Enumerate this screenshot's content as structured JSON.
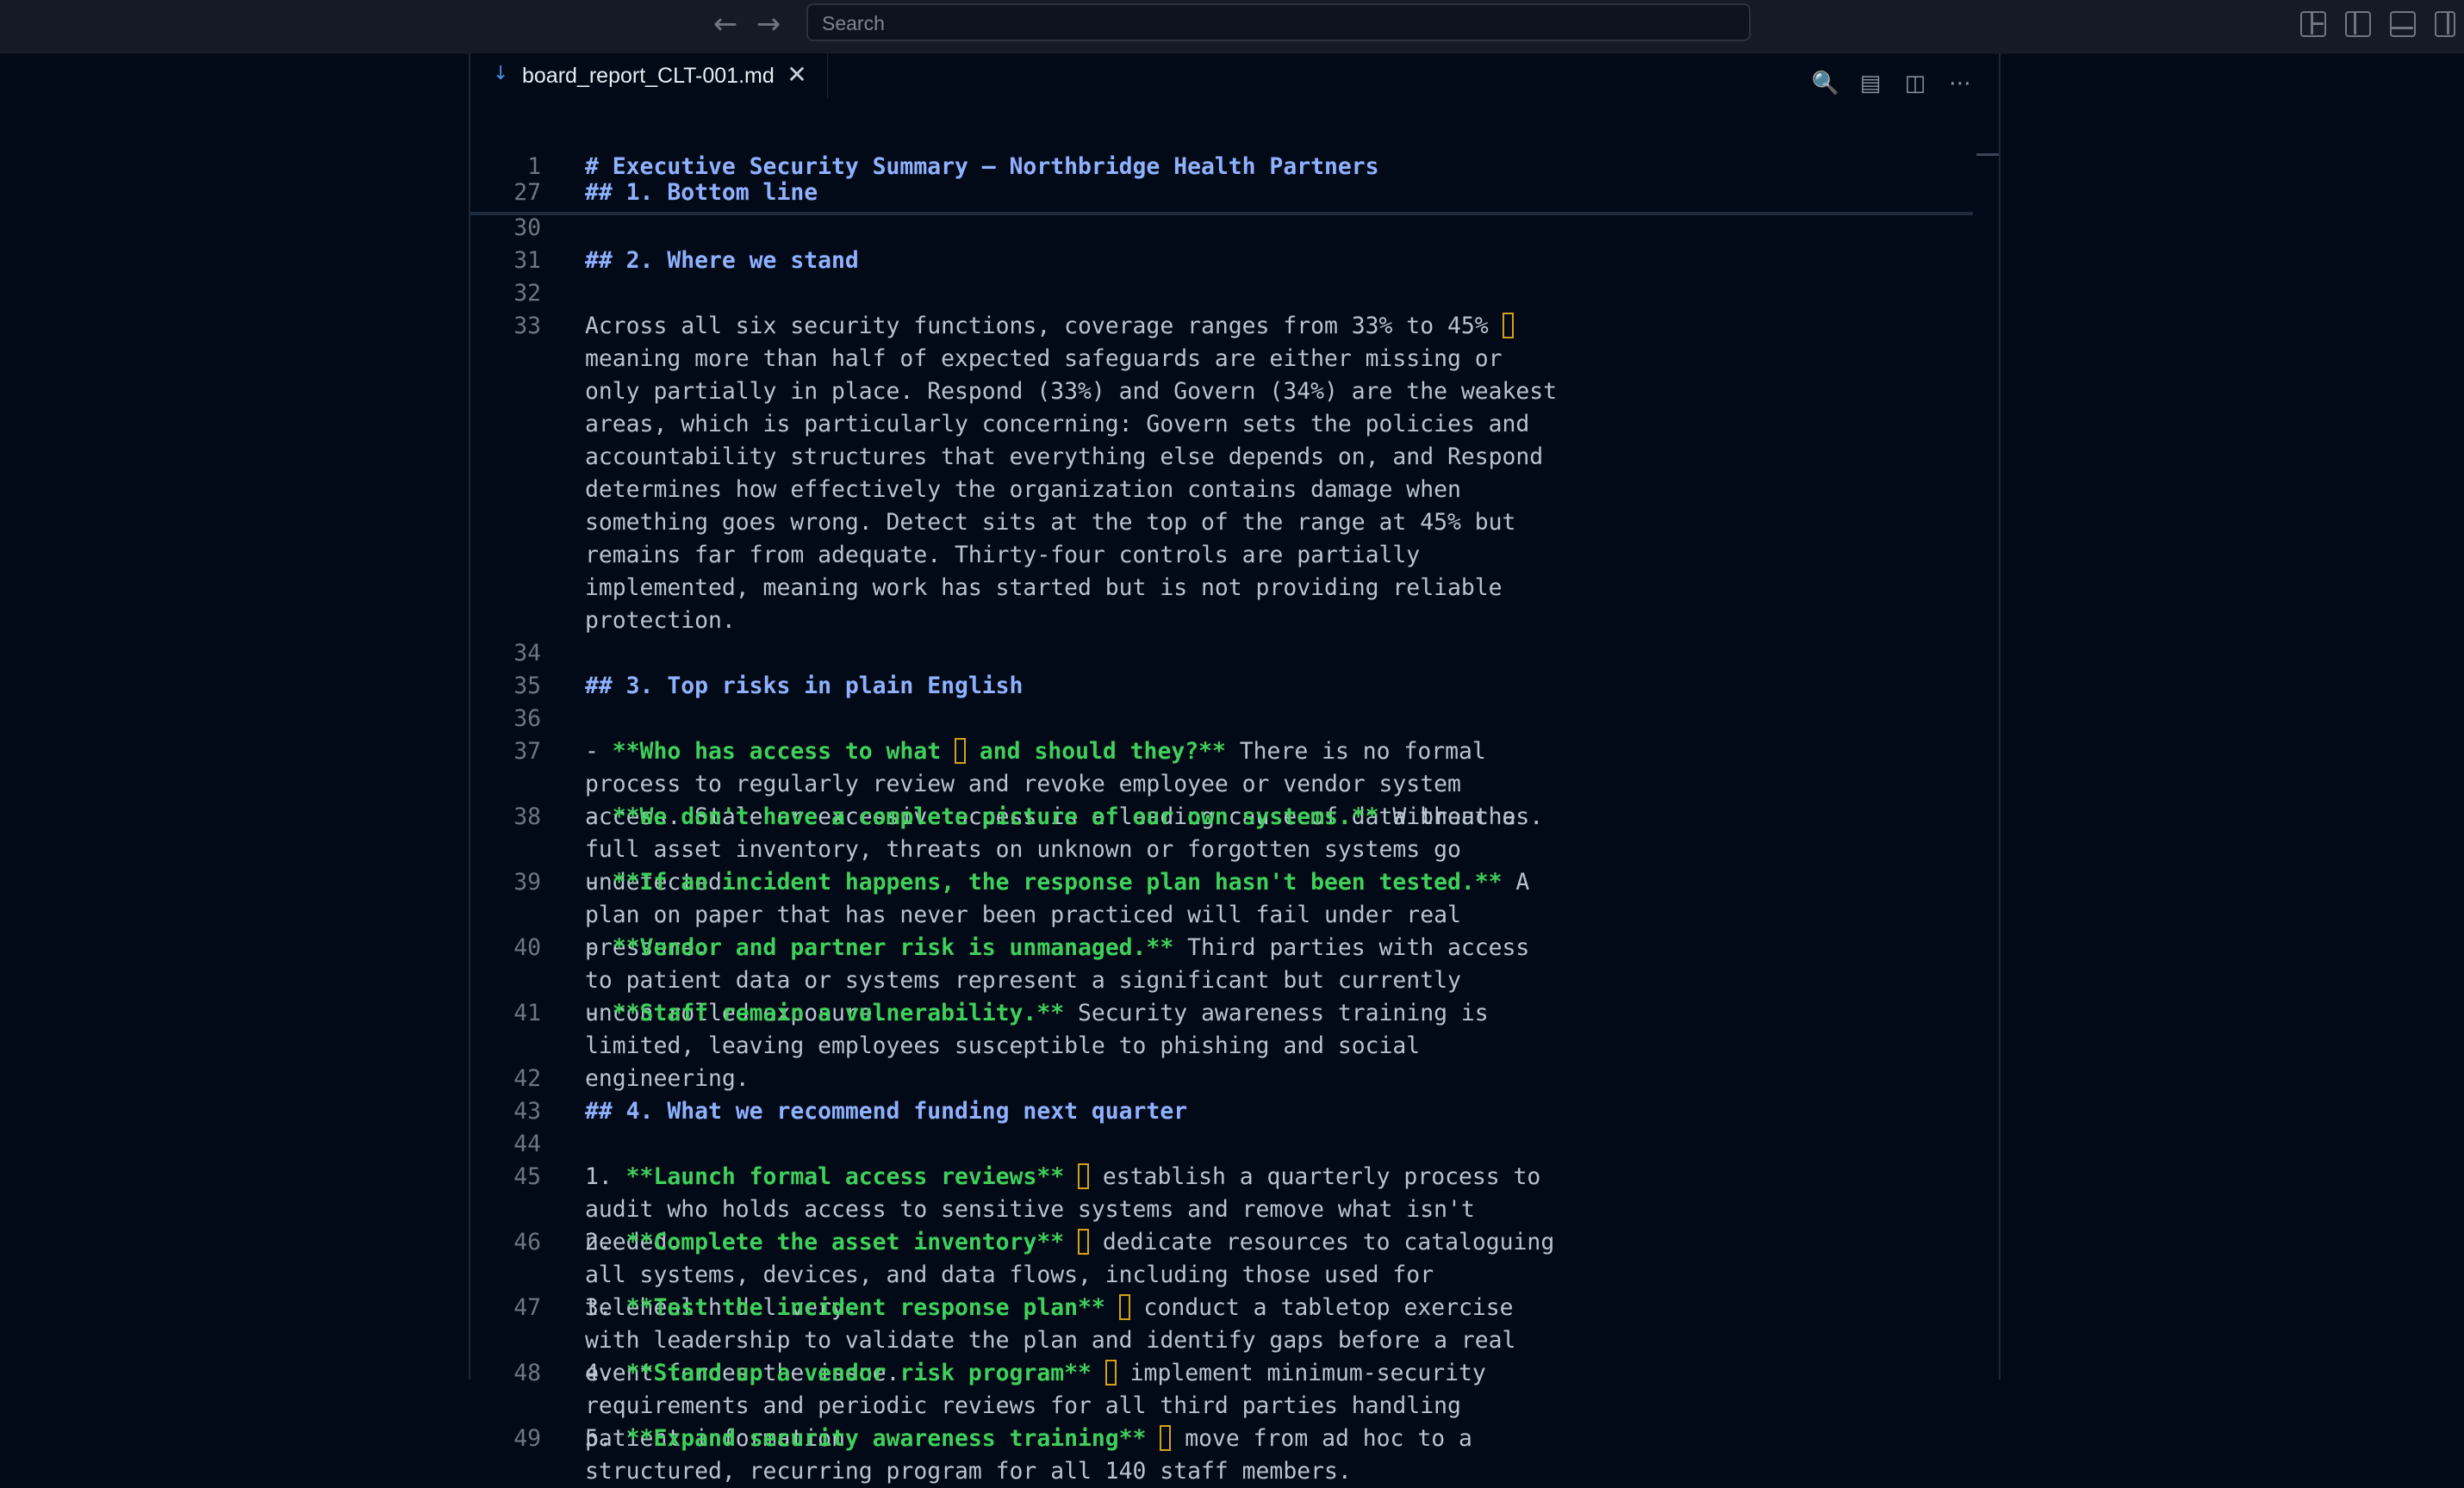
{
  "search": {
    "placeholder": "Search"
  },
  "tab": {
    "filename": "board_report_CLT-001.md"
  },
  "sticky": [
    {
      "ln": "1",
      "text": "# Executive Security Summary — Northbridge Health Partners"
    },
    {
      "ln": "27",
      "text": "## 1. Bottom line"
    }
  ],
  "lines": {
    "l30": {
      "ln": "30"
    },
    "l31": {
      "ln": "31",
      "text": "## 2. Where we stand"
    },
    "l32": {
      "ln": "32"
    },
    "l33": {
      "ln": "33",
      "a": "Across all six security functions, coverage ranges from 33% to 45% ",
      "b": " meaning more than half of expected safeguards are either missing or only partially in place. Respond (33%) and Govern (34%) are the weakest areas, which is particularly concerning: Govern sets the policies and accountability structures that everything else depends on, and Respond determines how effectively the organization contains damage when something goes wrong. Detect sits at the top of the range at 45% but remains far from adequate. Thirty-four controls are partially implemented, meaning work has started but is not providing reliable protection."
    },
    "l34": {
      "ln": "34"
    },
    "l35": {
      "ln": "35",
      "text": "## 3. Top risks in plain English"
    },
    "l36": {
      "ln": "36"
    },
    "l37": {
      "ln": "37",
      "m": "- ",
      "b1": "**Who has access to what ",
      "b2": " and should they?**",
      "rest": " There is no formal process to regularly review and revoke employee or vendor system access. Stale or excessive access is a leading cause of data breaches."
    },
    "l38": {
      "ln": "38",
      "m": "- ",
      "bold": "**We don't have a complete picture of our own systems.**",
      "rest": " Without a full asset inventory, threats on unknown or forgotten systems go undetected."
    },
    "l39": {
      "ln": "39",
      "m": "- ",
      "bold": "**If an incident happens, the response plan hasn't been tested.**",
      "rest": " A plan on paper that has never been practiced will fail under real pressure."
    },
    "l40": {
      "ln": "40",
      "m": "- ",
      "bold": "**Vendor and partner risk is unmanaged.**",
      "rest": " Third parties with access to patient data or systems represent a significant but currently uncontrolled exposure."
    },
    "l41": {
      "ln": "41",
      "m": "- ",
      "bold": "**Staff remain a vulnerability.**",
      "rest": " Security awareness training is limited, leaving employees susceptible to phishing and social engineering."
    },
    "l42": {
      "ln": "42"
    },
    "l43": {
      "ln": "43",
      "text": "## 4. What we recommend funding next quarter"
    },
    "l44": {
      "ln": "44"
    },
    "l45": {
      "ln": "45",
      "m": "1. ",
      "bold": "**Launch formal access reviews**",
      "rest": " establish a quarterly process to audit who holds access to sensitive systems and remove what isn't needed."
    },
    "l46": {
      "ln": "46",
      "m": "2. ",
      "bold": "**Complete the asset inventory**",
      "rest": " dedicate resources to cataloguing all systems, devices, and data flows, including those used for telehealth delivery."
    },
    "l47": {
      "ln": "47",
      "m": "3. ",
      "bold": "**Test the incident response plan**",
      "rest": " conduct a tabletop exercise with leadership to validate the plan and identify gaps before a real event forces the issue."
    },
    "l48": {
      "ln": "48",
      "m": "4. ",
      "bold": "**Stand up a vendor risk program**",
      "rest": " implement minimum-security requirements and periodic reviews for all third parties handling patient information."
    },
    "l49": {
      "ln": "49",
      "m": "5. ",
      "bold": "**Expand security awareness training**",
      "rest": " move from ad hoc to a structured, recurring program for all 140 staff members."
    }
  }
}
